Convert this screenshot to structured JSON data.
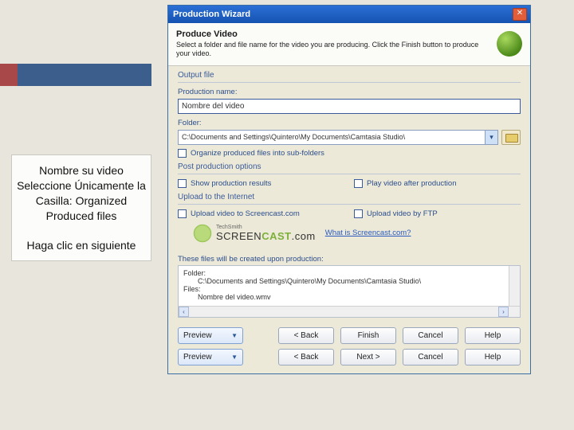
{
  "instruction": {
    "para1": "Nombre su video Seleccione Únicamente la Casilla: Organized Produced files",
    "para2": "Haga clic en siguiente"
  },
  "dialog": {
    "title": "Production Wizard",
    "header": {
      "title": "Produce Video",
      "subtitle": "Select a folder and file name for the video you are producing. Click the Finish button to produce your video."
    },
    "output": {
      "group_title": "Output file",
      "prod_name_label": "Production name:",
      "prod_name_value": "Nombre del video",
      "folder_label": "Folder:",
      "folder_value": "C:\\Documents and Settings\\Quintero\\My Documents\\Camtasia Studio\\",
      "organize_label": "Organize produced files into sub-folders"
    },
    "post": {
      "group_title": "Post production options",
      "show_results": "Show production results",
      "play_after": "Play video after production"
    },
    "upload": {
      "group_title": "Upload to the Internet",
      "sc_label": "Upload video to Screencast.com",
      "ftp_label": "Upload video by FTP",
      "brand_small": "TechSmith",
      "brand_main_pre": "SCREEN",
      "brand_main_post": "CAST",
      "brand_suffix": ".com",
      "link": "What is Screencast.com?"
    },
    "preview": {
      "intro": "These files will be created upon production:",
      "folder_label": "Folder:",
      "folder_value": "C:\\Documents and Settings\\Quintero\\My Documents\\Camtasia Studio\\",
      "files_label": "Files:",
      "files_value": "Nombre del video.wmv"
    },
    "buttons": {
      "preview": "Preview",
      "back": "< Back",
      "finish": "Finish",
      "next": "Next >",
      "cancel": "Cancel",
      "help": "Help"
    }
  }
}
